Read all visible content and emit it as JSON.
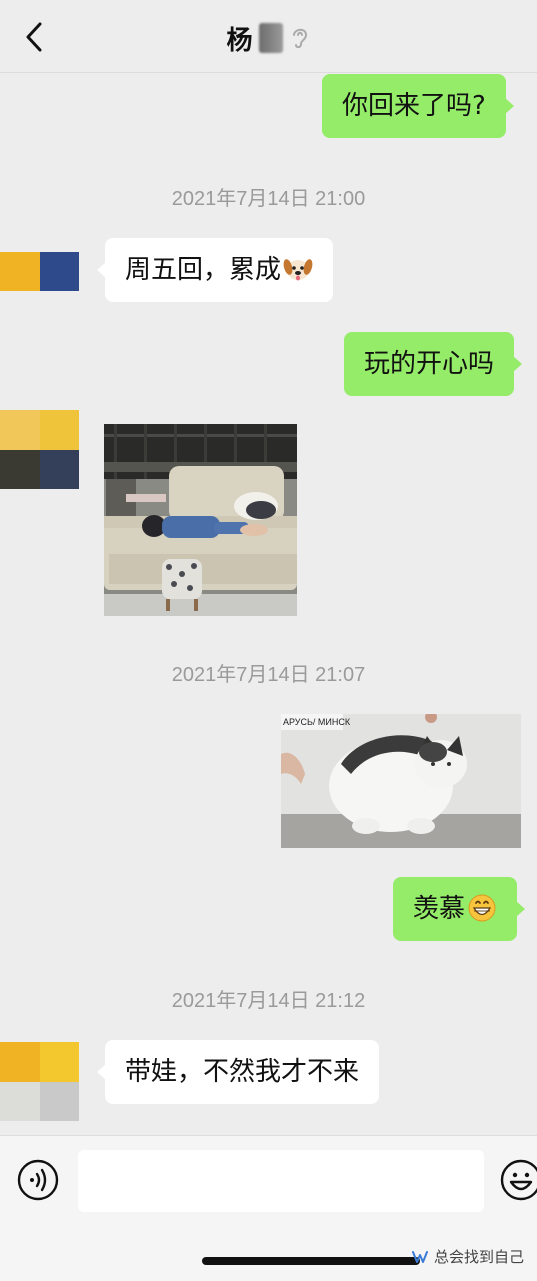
{
  "header": {
    "title": "杨",
    "back_icon": "chevron-left-icon",
    "mute_icon": "ear-icon"
  },
  "messages": [
    {
      "type": "text",
      "dir": "out",
      "text": "你回来了吗?"
    },
    {
      "type": "timestamp",
      "text": "2021年7月14日 21:00"
    },
    {
      "type": "text",
      "dir": "in",
      "text": "周五回，累成",
      "emoji": "dog-face-emoji"
    },
    {
      "type": "text",
      "dir": "out",
      "text": "玩的开心吗"
    },
    {
      "type": "image",
      "dir": "in",
      "description": "child-on-sofa-photo"
    },
    {
      "type": "timestamp",
      "text": "2021年7月14日 21:07"
    },
    {
      "type": "image",
      "dir": "out",
      "description": "fat-cat-video-still",
      "caption": "АРУСЬ/ МИНСК"
    },
    {
      "type": "text",
      "dir": "out",
      "text": "羡慕",
      "emoji": "grinning-face-emoji"
    },
    {
      "type": "timestamp",
      "text": "2021年7月14日 21:12"
    },
    {
      "type": "text",
      "dir": "in",
      "text": "带娃，不然我才不来"
    }
  ],
  "input": {
    "value": "",
    "voice_icon": "voice-icon",
    "emoji_icon": "emoji-icon"
  },
  "watermark": {
    "text": "总会找到自己",
    "icon": "wechat-channel-icon"
  },
  "colors": {
    "background": "#ededed",
    "outgoing_bubble": "#95ec69",
    "incoming_bubble": "#ffffff",
    "timestamp": "#9a9a9a"
  }
}
